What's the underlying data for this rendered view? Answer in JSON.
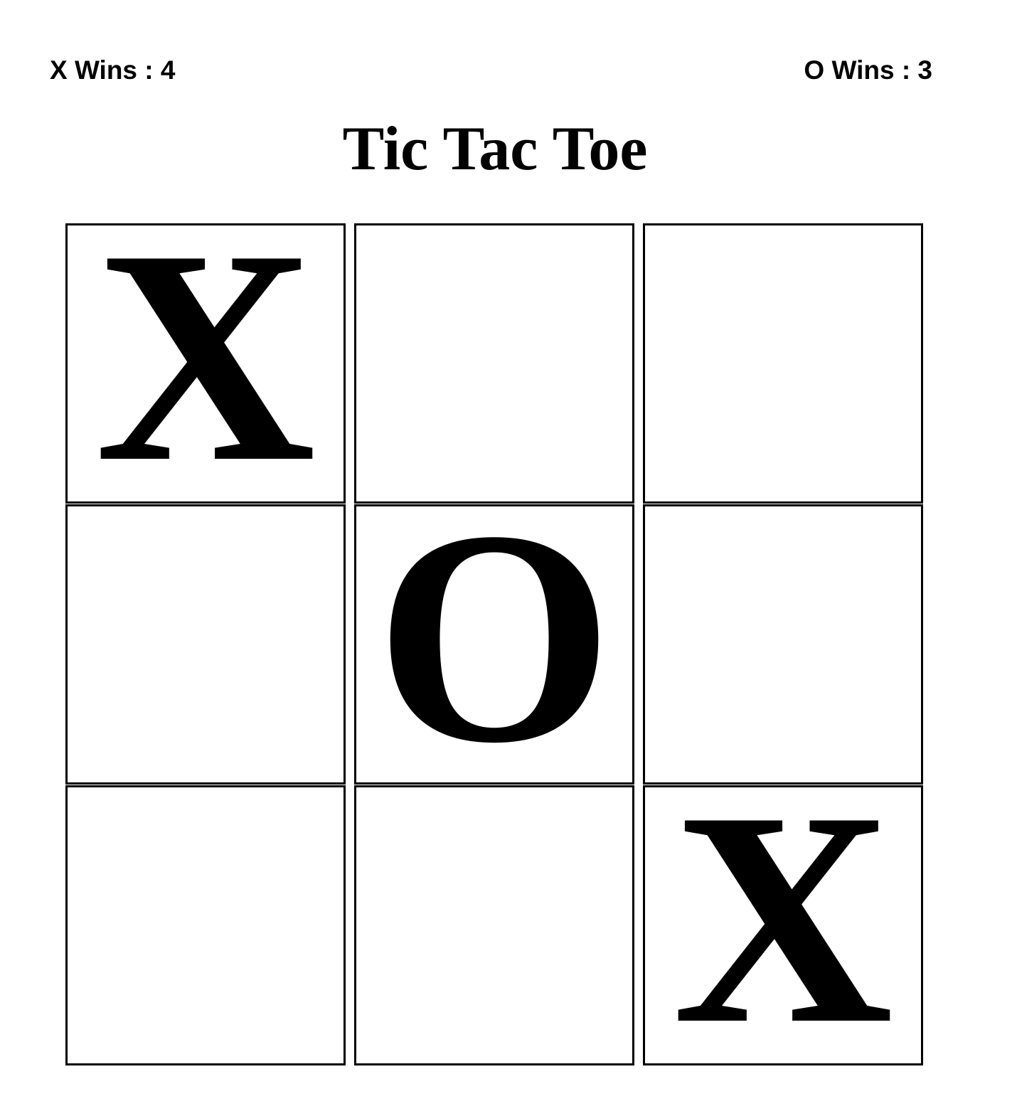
{
  "scores": {
    "x_label": "X Wins : 4",
    "o_label": "O Wins : 3"
  },
  "title": "Tic Tac Toe",
  "board": {
    "cells": [
      "X",
      "",
      "",
      "",
      "O",
      "",
      "",
      "",
      "X"
    ]
  },
  "colors": {
    "background": "#ffffff",
    "ink": "#000000"
  }
}
